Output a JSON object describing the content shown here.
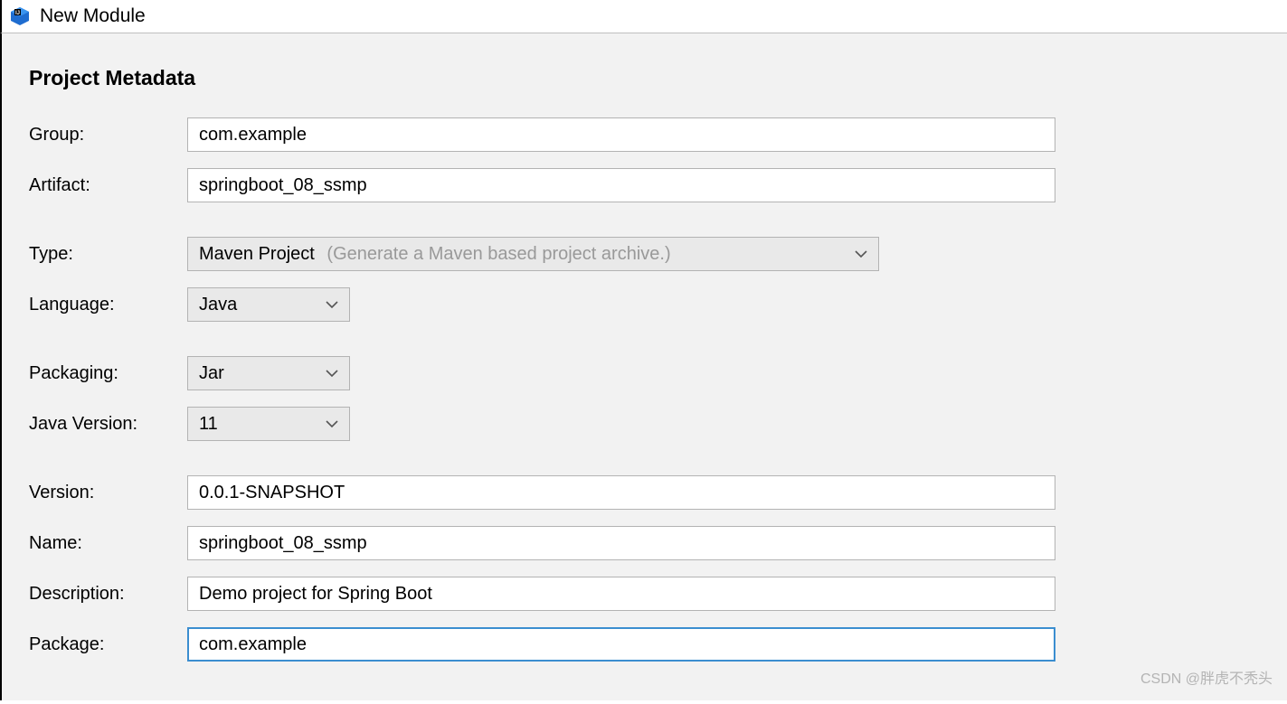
{
  "window": {
    "title": "New Module"
  },
  "section": {
    "title": "Project Metadata"
  },
  "form": {
    "group": {
      "label": "Group:",
      "value": "com.example"
    },
    "artifact": {
      "label": "Artifact:",
      "value": "springboot_08_ssmp"
    },
    "type": {
      "label": "Type:",
      "value": "Maven Project",
      "hint": "(Generate a Maven based project archive.)"
    },
    "language": {
      "label": "Language:",
      "value": "Java"
    },
    "packaging": {
      "label": "Packaging:",
      "value": "Jar"
    },
    "javaVersion": {
      "label": "Java Version:",
      "value": "11"
    },
    "version": {
      "label": "Version:",
      "value": "0.0.1-SNAPSHOT"
    },
    "name": {
      "label": "Name:",
      "value": "springboot_08_ssmp"
    },
    "description": {
      "label": "Description:",
      "value": "Demo project for Spring Boot"
    },
    "package": {
      "label": "Package:",
      "value": "com.example"
    }
  },
  "watermark": "CSDN @胖虎不秃头"
}
